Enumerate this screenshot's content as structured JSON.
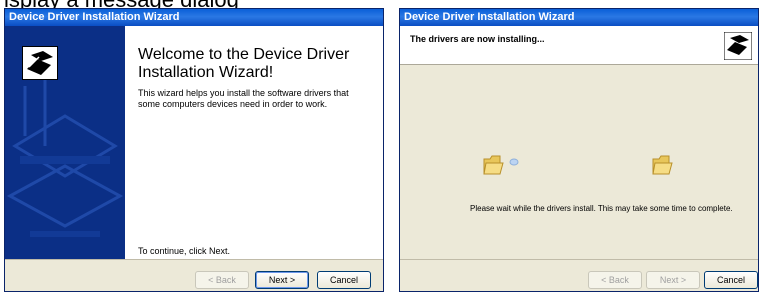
{
  "top_fragment": "ispiay a message dialog",
  "left_window": {
    "title": "Device Driver Installation Wizard",
    "heading": "Welcome to the Device Driver Installation Wizard!",
    "description": "This wizard helps you install the software drivers that some computers devices need in order to work.",
    "continue_text": "To continue, click Next.",
    "buttons": {
      "back": "< Back",
      "next": "Next >",
      "cancel": "Cancel"
    }
  },
  "right_window": {
    "title": "Device Driver Installation Wizard",
    "header_text": "The drivers are now installing...",
    "wait_text": "Please wait while the drivers install. This may take some time to complete.",
    "buttons": {
      "back": "< Back",
      "next": "Next >",
      "cancel": "Cancel"
    }
  }
}
